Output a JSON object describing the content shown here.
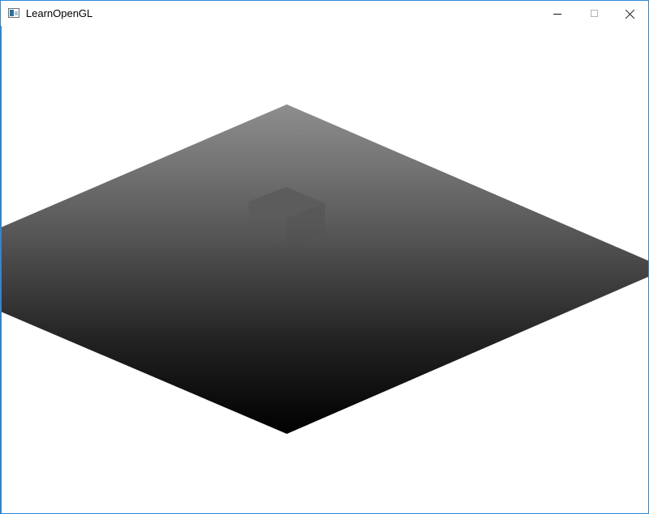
{
  "window": {
    "title": "LearnOpenGL",
    "controls": {
      "minimize_icon": "minimize-icon",
      "maximize_icon": "maximize-icon",
      "close_icon": "close-icon"
    }
  },
  "scene": {
    "description_visible": "",
    "colors": {
      "background": "#ffffff",
      "plane_top": "#8a8a8a",
      "plane_bottom": "#000000",
      "cube_top": "#5b5b5b",
      "cube_bottom": "#4a4a4a"
    }
  }
}
